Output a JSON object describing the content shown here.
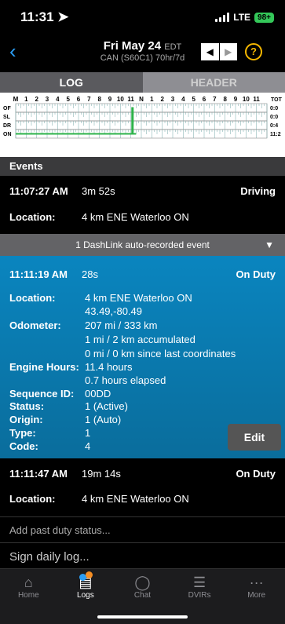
{
  "status": {
    "time": "11:31",
    "network": "LTE",
    "battery": "98+"
  },
  "nav": {
    "date": "Fri May 24",
    "tz": "EDT",
    "cycle": "CAN (S60C1) 70hr/7d"
  },
  "tabs": {
    "log": "LOG",
    "header": "HEADER"
  },
  "grid": {
    "hour_labels": [
      "M",
      "1",
      "2",
      "3",
      "4",
      "5",
      "6",
      "7",
      "8",
      "9",
      "10",
      "11",
      "N",
      "1",
      "2",
      "3",
      "4",
      "5",
      "6",
      "7",
      "8",
      "9",
      "10",
      "11"
    ],
    "tot_label": "TOT",
    "rows": [
      "OF",
      "SL",
      "DR",
      "ON"
    ],
    "totals": [
      "0:0",
      "0:0",
      "0:4",
      "11:2"
    ]
  },
  "events": {
    "title": "Events",
    "e1": {
      "time": "11:07:27 AM",
      "duration": "3m 52s",
      "status": "Driving",
      "loc_label": "Location:",
      "loc": "4 km ENE Waterloo ON"
    },
    "dashlink": "1 DashLink auto-recorded event",
    "e2": {
      "time": "11:11:19 AM",
      "duration": "28s",
      "status": "On Duty",
      "loc_label": "Location:",
      "loc1": "4 km ENE Waterloo ON",
      "loc2": "43.49,-80.49",
      "odo_label": "Odometer:",
      "odo1": "207 mi / 333 km",
      "odo2": "1 mi / 2 km accumulated",
      "odo3": "0 mi / 0 km since last coordinates",
      "eng_label": "Engine Hours:",
      "eng1": "11.4 hours",
      "eng2": "0.7 hours elapsed",
      "seq_label": "Sequence ID:",
      "seq": "00DD",
      "status_label": "Status:",
      "status_val": "1 (Active)",
      "origin_label": "Origin:",
      "origin": "1 (Auto)",
      "type_label": "Type:",
      "type": "1",
      "code_label": "Code:",
      "code": "4",
      "edit": "Edit"
    },
    "e3": {
      "time": "11:11:47 AM",
      "duration": "19m 14s",
      "status": "On Duty",
      "loc_label": "Location:",
      "loc": "4 km ENE Waterloo ON"
    }
  },
  "add_past": "Add past duty status...",
  "sign": "Sign daily log...",
  "tabbar": [
    {
      "icon": "home-icon",
      "label": "Home"
    },
    {
      "icon": "logs-icon",
      "label": "Logs"
    },
    {
      "icon": "chat-icon",
      "label": "Chat"
    },
    {
      "icon": "dvirs-icon",
      "label": "DVIRs"
    },
    {
      "icon": "more-icon",
      "label": "More"
    }
  ],
  "colors": {
    "accent": "#2a9df4",
    "duty_line": "#2db34a",
    "event_blue": "#0a85bf",
    "help": "#f5b700"
  }
}
